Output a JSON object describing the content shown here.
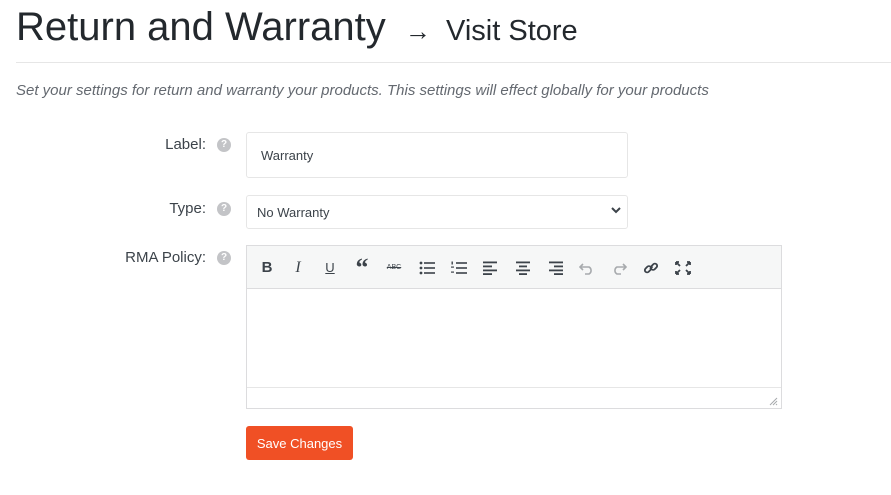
{
  "header": {
    "title": "Return and Warranty",
    "arrow": "→",
    "visit_store": "Visit Store"
  },
  "description": "Set your settings for return and warranty your products. This settings will effect globally for your products",
  "form": {
    "label_field": {
      "label": "Label:",
      "value": "Warranty"
    },
    "type_field": {
      "label": "Type:",
      "selected": "No Warranty"
    },
    "rma_field": {
      "label": "RMA Policy:"
    },
    "help_glyph": "?"
  },
  "editor": {
    "toolbar": [
      "bold-icon",
      "italic-icon",
      "underline-icon",
      "blockquote-icon",
      "strikethrough-icon",
      "bullet-list-icon",
      "numbered-list-icon",
      "align-left-icon",
      "align-center-icon",
      "align-right-icon",
      "undo-icon",
      "redo-icon",
      "link-icon",
      "fullscreen-icon"
    ],
    "bold": "B",
    "italic": "I",
    "underline": "U",
    "quote": "“",
    "strike": "ABC",
    "content": ""
  },
  "actions": {
    "save_label": "Save Changes"
  },
  "colors": {
    "accent": "#f05025",
    "text": "#3c434a",
    "border": "#e6e6e6"
  }
}
